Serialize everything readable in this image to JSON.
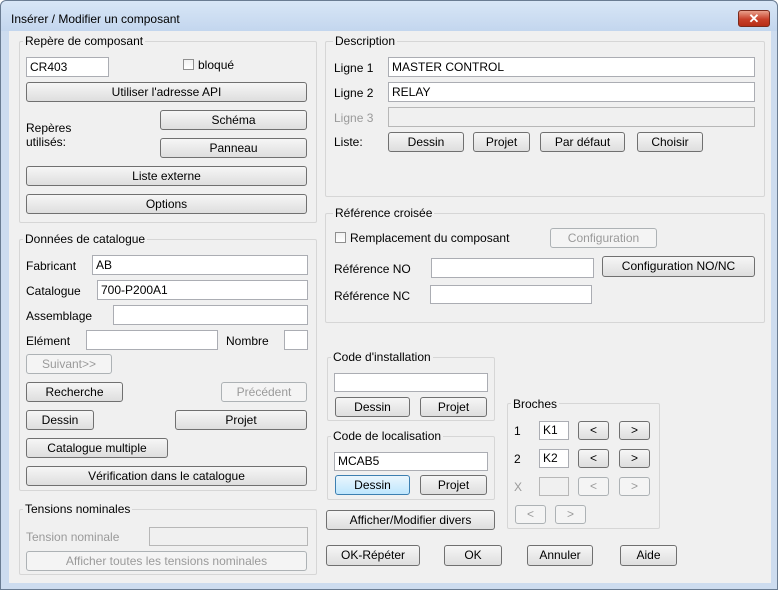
{
  "window": {
    "title": "Insérer / Modifier un composant",
    "close_label": "✕"
  },
  "repere": {
    "legend": "Repère de composant",
    "value": "CR403",
    "bloque_label": "bloqué",
    "api_button": "Utiliser l'adresse API",
    "reperes_label_1": "Repères",
    "reperes_label_2": "utilisés:",
    "schema_button": "Schéma",
    "panneau_button": "Panneau",
    "liste_externe_button": "Liste externe",
    "options_button": "Options"
  },
  "catalogue": {
    "legend": "Données de catalogue",
    "fabricant_label": "Fabricant",
    "fabricant_value": "AB",
    "catalogue_label": "Catalogue",
    "catalogue_value": "700-P200A1",
    "assemblage_label": "Assemblage",
    "assemblage_value": "",
    "element_label": "Elément",
    "element_value": "",
    "nombre_label": "Nombre",
    "nombre_value": "",
    "suivant_button": "Suivant>>",
    "recherche_button": "Recherche",
    "precedent_button": "Précédent",
    "dessin_button": "Dessin",
    "projet_button": "Projet",
    "multiple_button": "Catalogue multiple",
    "verification_button": "Vérification dans le catalogue"
  },
  "tensions": {
    "legend": "Tensions nominales",
    "tension_label": "Tension nominale",
    "tension_value": "",
    "afficher_button": "Afficher toutes les tensions nominales"
  },
  "description": {
    "legend": "Description",
    "ligne1_label": "Ligne 1",
    "ligne1_value": "MASTER CONTROL",
    "ligne2_label": "Ligne 2",
    "ligne2_value": "RELAY",
    "ligne3_label": "Ligne 3",
    "ligne3_value": "",
    "liste_label": "Liste:",
    "dessin_button": "Dessin",
    "projet_button": "Projet",
    "defaut_button": "Par défaut",
    "choisir_button": "Choisir"
  },
  "reference": {
    "legend": "Référence croisée",
    "remplacement_label": "Remplacement du composant",
    "configuration_button": "Configuration",
    "ref_no_label": "Référence NO",
    "ref_no_value": "",
    "config_nonc_button": "Configuration NO/NC",
    "ref_nc_label": "Référence NC",
    "ref_nc_value": ""
  },
  "installation": {
    "legend": "Code d'installation",
    "value": "",
    "dessin_button": "Dessin",
    "projet_button": "Projet"
  },
  "localisation": {
    "legend": "Code de localisation",
    "value": "MCAB5",
    "dessin_button": "Dessin",
    "projet_button": "Projet"
  },
  "divers_button": "Afficher/Modifier divers",
  "broches": {
    "legend": "Broches",
    "row1_label": "1",
    "row1_value": "K1",
    "row2_label": "2",
    "row2_value": "K2",
    "row3_label": "X",
    "row3_value": "",
    "prev_label": "<",
    "next_label": ">"
  },
  "footer": {
    "ok_repeter": "OK-Répéter",
    "ok": "OK",
    "annuler": "Annuler",
    "aide": "Aide"
  }
}
